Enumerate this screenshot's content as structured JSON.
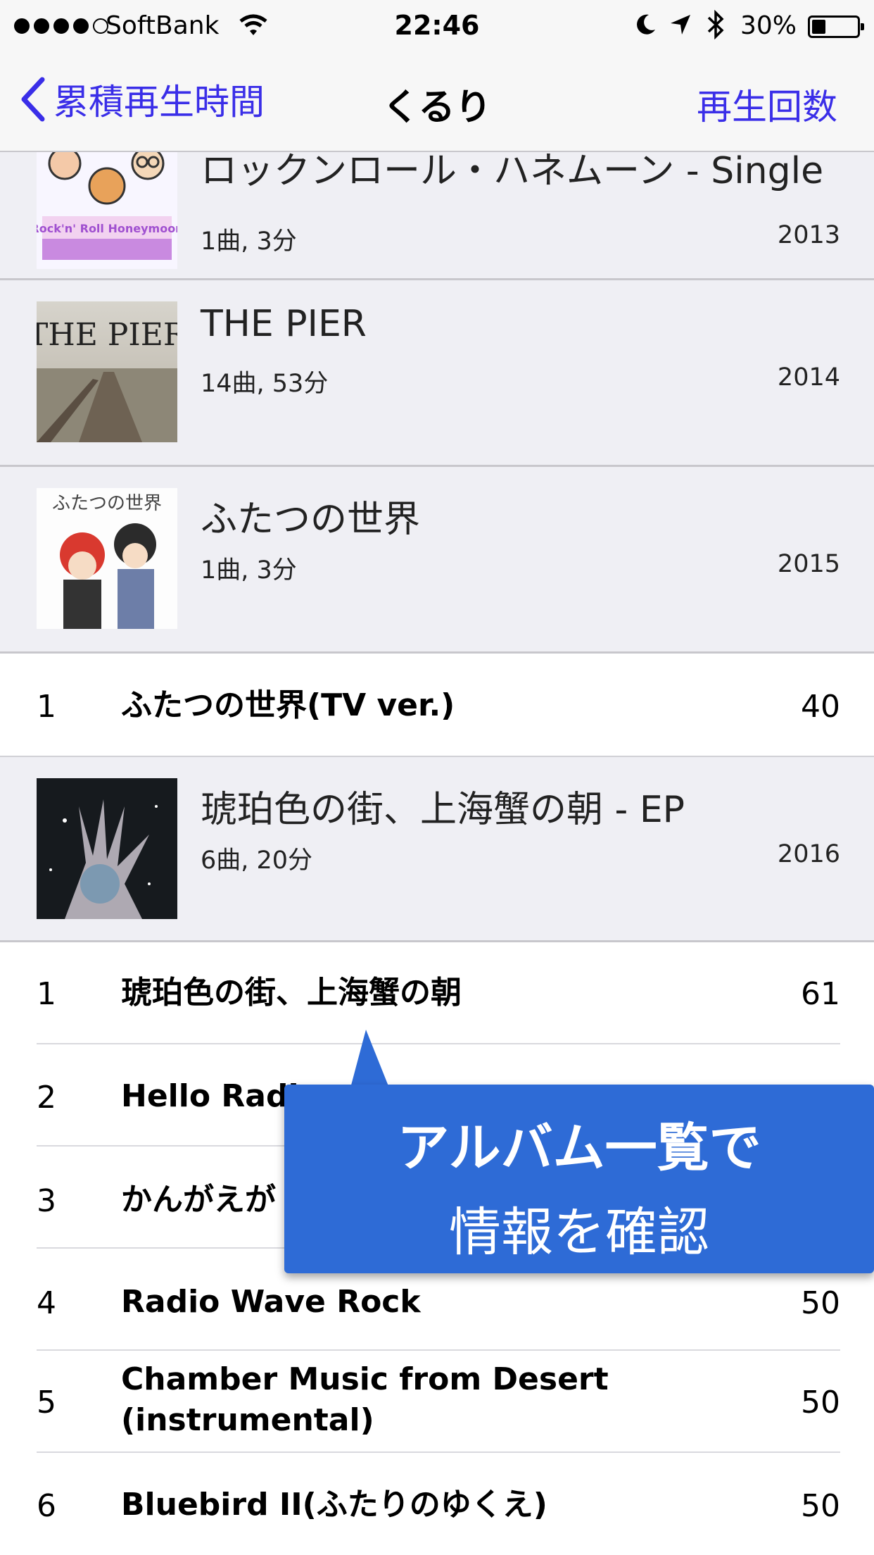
{
  "status_bar": {
    "carrier": "SoftBank",
    "time": "22:46",
    "battery": "30%",
    "battery_level": 0.3
  },
  "nav": {
    "back_label": "累積再生時間",
    "title": "くるり",
    "right_label": "再生回数"
  },
  "albums": [
    {
      "title": "ロックンロール・ハネムーン - Single",
      "meta": "1曲, 3分",
      "year": "2013",
      "art_text": "Rock'n' Roll Honeymoon"
    },
    {
      "title": "THE PIER",
      "meta": "14曲, 53分",
      "year": "2014",
      "art_text": "THE PIER"
    },
    {
      "title": "ふたつの世界",
      "meta": "1曲, 3分",
      "year": "2015",
      "art_text": "ふたつの世界"
    },
    {
      "title": "琥珀色の街、上海蟹の朝 - EP",
      "meta": "6曲, 20分",
      "year": "2016"
    }
  ],
  "songs_album3": [
    {
      "num": "1",
      "title": "ふたつの世界(TV ver.)",
      "count": "40"
    }
  ],
  "songs_album4": [
    {
      "num": "1",
      "title": "琥珀色の街、上海蟹の朝",
      "count": "61"
    },
    {
      "num": "2",
      "title": "Hello Radi",
      "count": ""
    },
    {
      "num": "3",
      "title": "かんがえが",
      "count": ""
    },
    {
      "num": "4",
      "title": "Radio Wave Rock",
      "count": "50"
    },
    {
      "num": "5",
      "title": "Chamber Music from Desert (instrumental)",
      "count": "50"
    },
    {
      "num": "6",
      "title": "Bluebird II(ふたりのゆくえ)",
      "count": "50"
    }
  ],
  "callout": {
    "line1": "アルバム一覧で",
    "line2": "情報を確認"
  },
  "colors": {
    "accent": "#3a2ee8",
    "callout": "#2e6bd6",
    "section_bg": "#efeff4"
  },
  "icons": [
    "chevron-left-icon",
    "wifi-icon",
    "moon-icon",
    "location-arrow-icon",
    "bluetooth-icon",
    "battery-icon"
  ]
}
